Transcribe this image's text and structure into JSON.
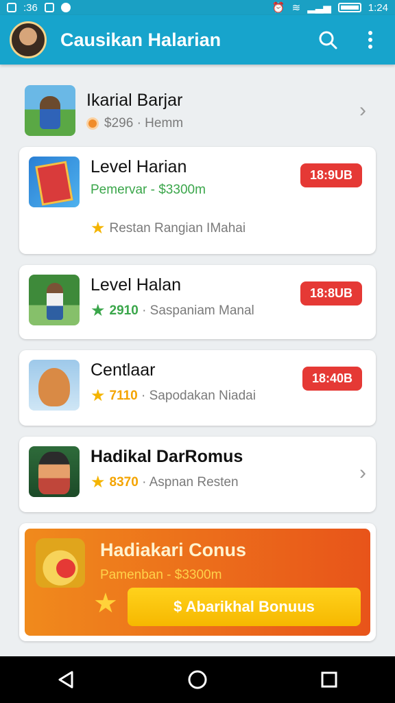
{
  "status_bar": {
    "left_text": ":36",
    "time": "1:24"
  },
  "app_bar": {
    "title": "Causikan Halarian",
    "icons": [
      "search-icon",
      "more-vert-icon"
    ]
  },
  "items": [
    {
      "title": "Ikarial Barjar",
      "sub_num": "$296",
      "sub_text": "· Hemm",
      "icon": "coin-icon"
    },
    {
      "title": "Level Harian",
      "sub_text": "Pemervar - $3300m",
      "note": "Restan Rangian IMahai",
      "badge": "18:9UB"
    },
    {
      "title": "Level Halan",
      "sub_num": "2910",
      "sub_text": "· Saspaniam Manal",
      "badge": "18:8UB"
    },
    {
      "title": "Centlaar",
      "sub_num": "7110",
      "sub_text": "· Sapodakan Niadai",
      "badge": "18:40B"
    },
    {
      "title": "Hadikal DarRomus",
      "sub_num": "8370",
      "sub_text": "· Aspnan Resten"
    }
  ],
  "bonus": {
    "title": "Hadiakari Conus",
    "sub_text": "Pamenban - $3300m",
    "button_label": "$ Abarikhal Bonuus"
  },
  "colors": {
    "app_bar": "#17a4cc",
    "badge": "#e53935",
    "green_text": "#3aa64a",
    "bonus_button": "#f6b800"
  }
}
